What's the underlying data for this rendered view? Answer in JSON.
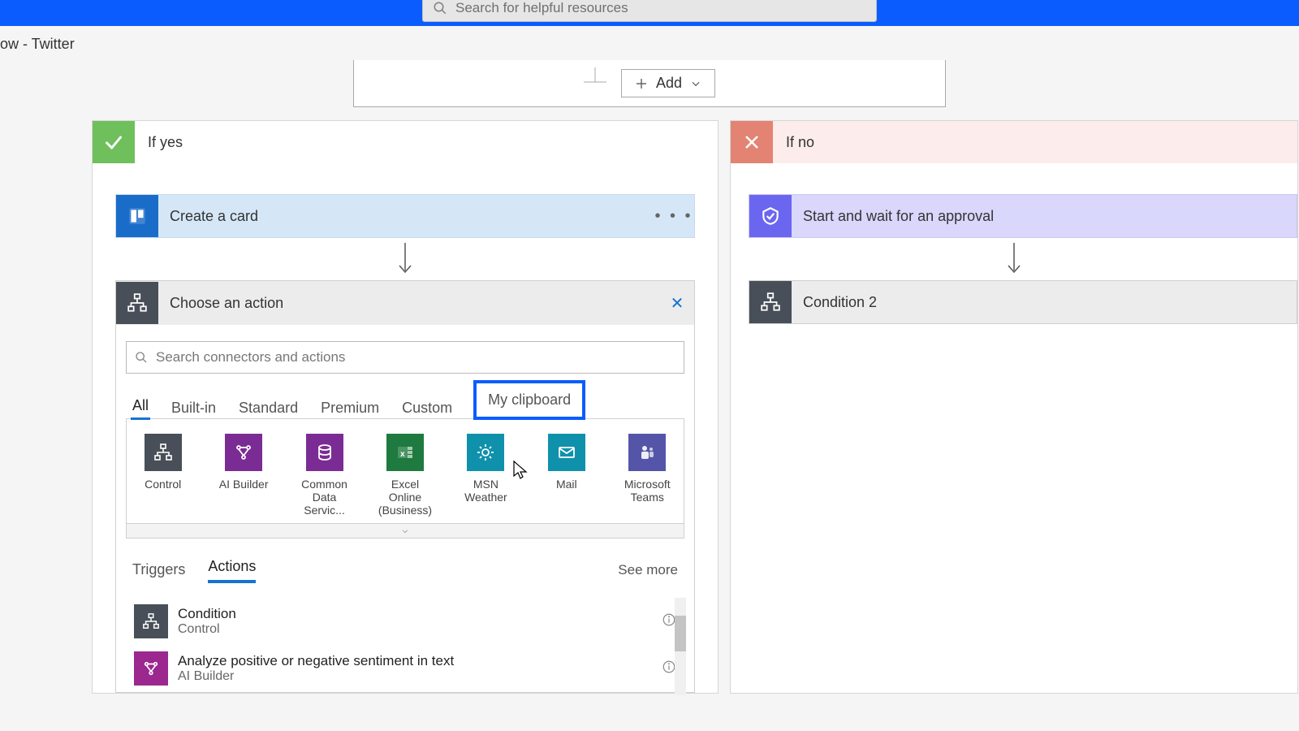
{
  "header": {
    "search_placeholder": "Search for helpful resources"
  },
  "breadcrumb": "ow - Twitter",
  "condition_top": {
    "add_label": "Add"
  },
  "branches": {
    "yes": {
      "title": "If yes",
      "card1": "Create a card",
      "choose": "Choose an action",
      "search_placeholder": "Search connectors and actions",
      "tabs": [
        "All",
        "Built-in",
        "Standard",
        "Premium",
        "Custom",
        "My clipboard"
      ],
      "connectors": [
        {
          "label": "Control",
          "cls": "t-control"
        },
        {
          "label": "AI Builder",
          "cls": "t-ai"
        },
        {
          "label": "Common Data Servic...",
          "cls": "t-cds"
        },
        {
          "label": "Excel Online (Business)",
          "cls": "t-excel"
        },
        {
          "label": "MSN Weather",
          "cls": "t-msn"
        },
        {
          "label": "Mail",
          "cls": "t-mail"
        },
        {
          "label": "Microsoft Teams",
          "cls": "t-teams"
        }
      ],
      "subtabs": {
        "triggers": "Triggers",
        "actions": "Actions",
        "seemore": "See more"
      },
      "actions": [
        {
          "title": "Condition",
          "sub": "Control",
          "cls": "sq-control"
        },
        {
          "title": "Analyze positive or negative sentiment in text",
          "sub": "AI Builder",
          "cls": "sq-ai"
        }
      ]
    },
    "no": {
      "title": "If no",
      "card1": "Start and wait for an approval",
      "card2": "Condition 2"
    }
  }
}
